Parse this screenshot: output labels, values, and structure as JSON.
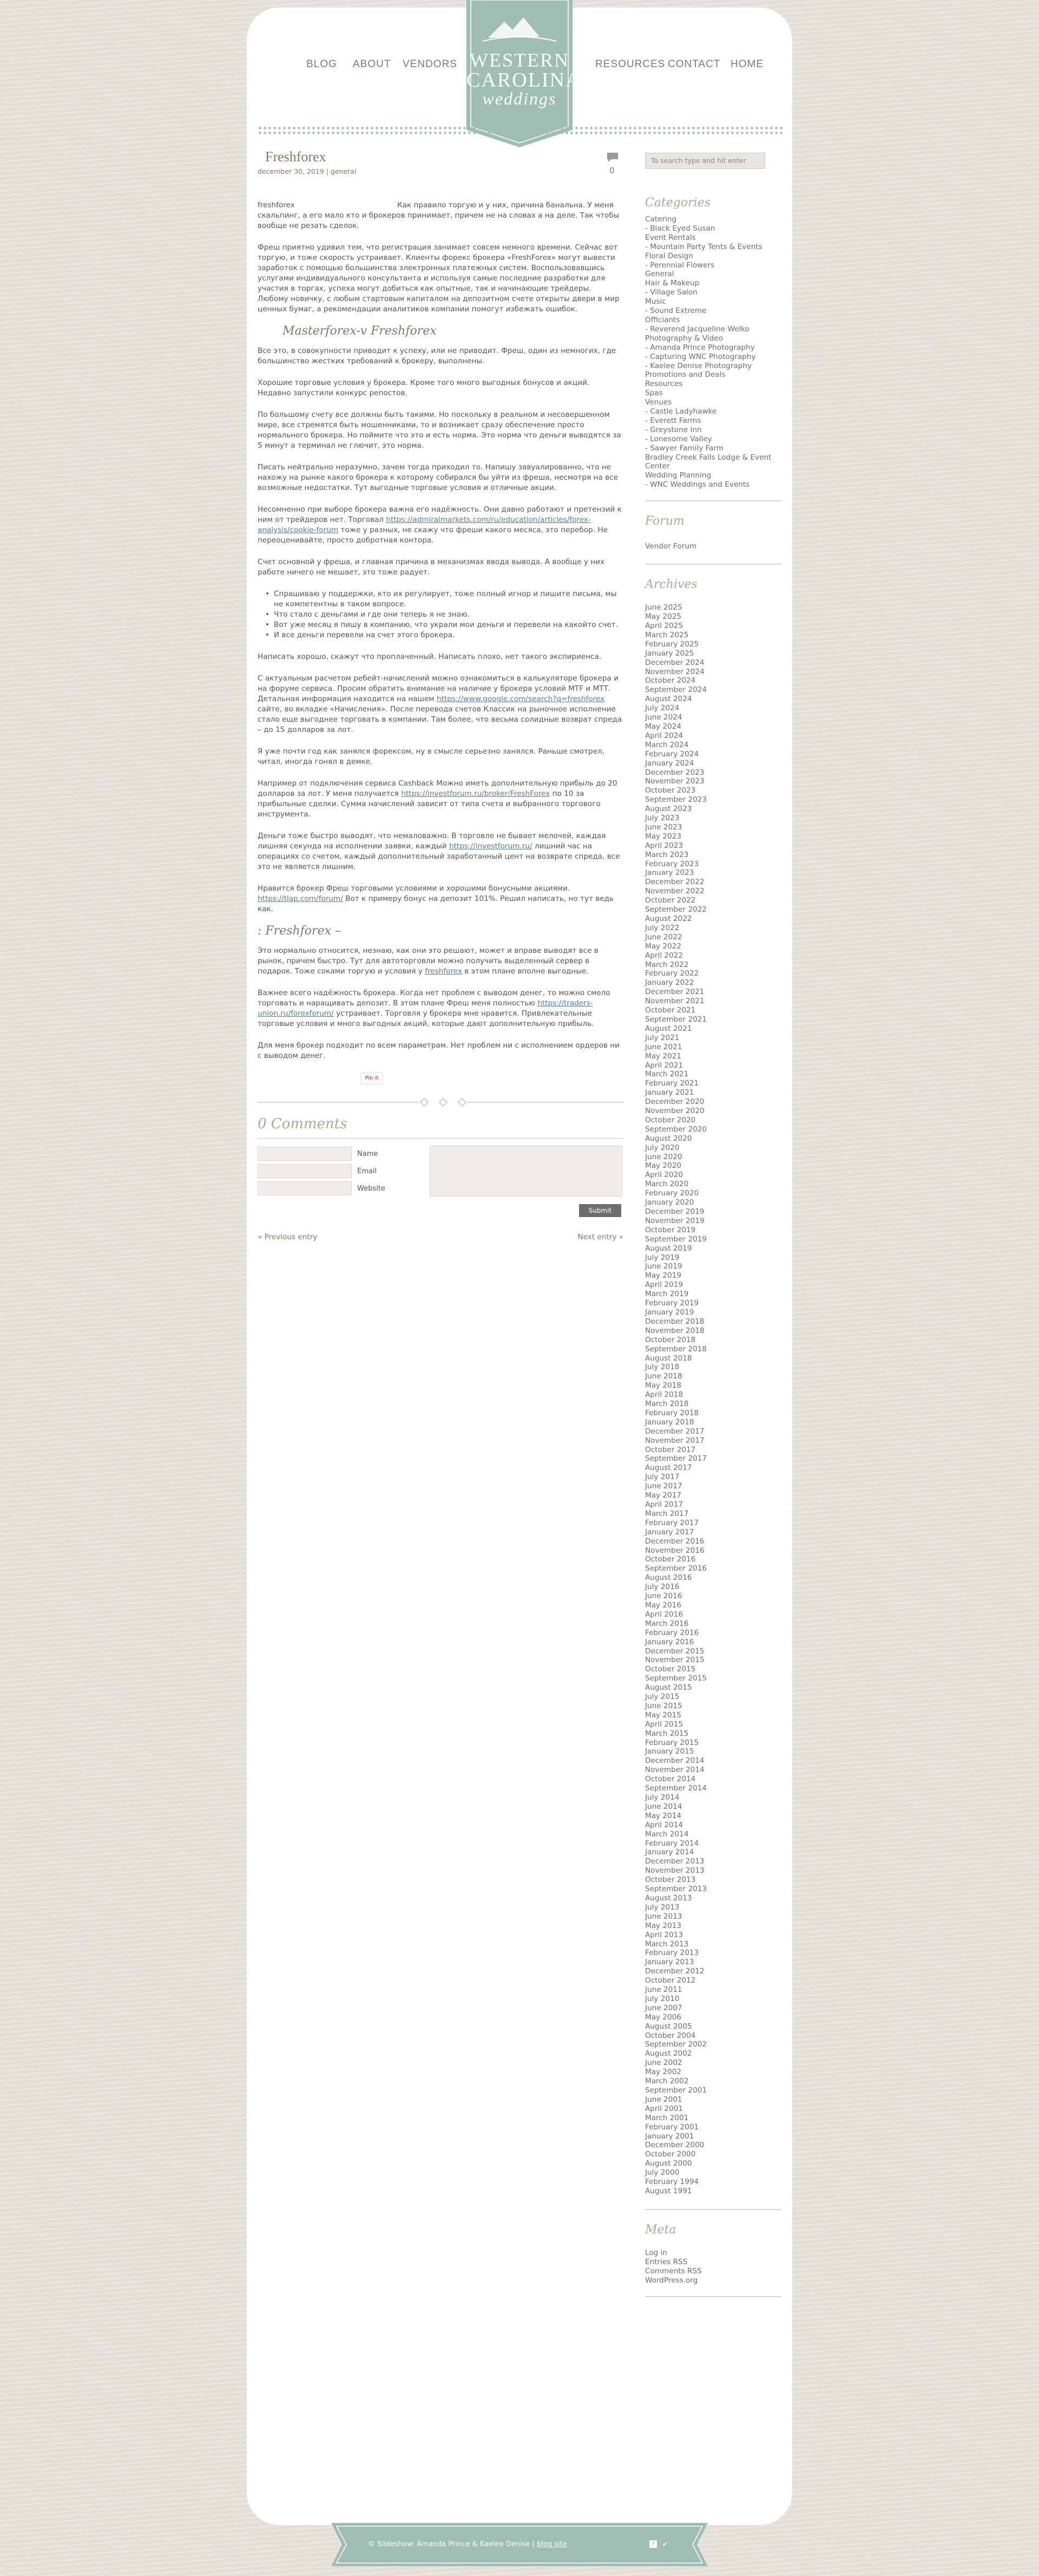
{
  "site": {
    "nav_left": [
      "BLOG",
      "ABOUT",
      "VENDORS"
    ],
    "nav_right": [
      "RESOURCES",
      "CONTACT",
      "HOME"
    ],
    "logo_line1": "WESTERN",
    "logo_line2": "CAROLINA",
    "logo_line3": "weddings",
    "brand_color": "#9fbdb4",
    "accent_color": "#8a7662"
  },
  "post": {
    "title": "Freshforex",
    "date_line": "december 30, 2019 | general",
    "comment_count": "0",
    "image_alt": "freshforex",
    "intro": "Как правило торгую и у них, причина банальна. У меня скальпинг, а его мало кто и брокеров принимает, причем не на словах а на деле. Так чтобы вообще не резать сделок.",
    "p1": "Фреш приятно удивил тем, что регистрация занимает совсем немного времени. Сейчас вот торгую, и тоже скорость устраивает. Клиенты форекс брокера «FreshForex» могут вывести заработок с помощью большинства электронных платежных систем. Воспользовавшись услугами индивидуального консультанта и используя самые последние разработки для участия в торгах, успеха могут добиться как опытные, так и начинающие трейдеры. Любому новичку, с любым стартовым капиталом на депозитном счете открыты двери в мир ценных бумаг, а рекомендации аналитиков компании помогут избежать ошибок.",
    "heading1": "Masterforex-v Freshforex",
    "p2": "Все это, в совокупности приводит к успеху, или не приводит. Фреш, один из немногих, где большинство жестких требований к брокеру, выполнены.",
    "p3": "Хорошие торговые условия у брокера. Кроме того много выгодных бонусов и акций. Недавно запустили конкурс репостов.",
    "p4": "По большому счету все должны быть такими. Но поскольку в реальном и несовершенном мире, все стремятся быть мошенниками, то и возникает сразу обеспечение просто нормального брокера. Но поймите что это и есть норма. Это норма что деньги выводятся за 5 минут а терминал не глючит, это норма.",
    "p5": "Писать нейтрально неразумно, зачем тогда приходил то. Напишу завуалированно, что не нахожу на рынке какого брокера к которому собирался бы уйти из фреша, несмотря на все возможные недостатки. Тут выгодные торговые условия и отличные акции.",
    "p6_a": "Несомненно при выборе брокера важна его надёжность. Они давно работают и претензий к ним от трейдеров нет. Торговал ",
    "p6_link": "https://admiralmarkets.com/ru/education/articles/forex-analysis/cookie-forum",
    "p6_b": " тоже у разных, не скажу что фреши какого месяса, это перебор. Не переоценивайте, просто добротная контора.",
    "p7": "Счет основной у фреша, и главная причина в механизмах ввода вывода. А вообще у них работе ничего не мешает, это тоже радует.",
    "list": [
      "Спрашиваю у поддержки, кто их регулирует, тоже полный игнор и пишите письма, мы не компетентны в таком вопросе.",
      "Что стало с деньгами и где они теперь я не знаю.",
      "Вот уже месяц я пишу в компанию, что украли мои деньги и перевели на какойто счет.",
      "И все деньги перевели на счет этого брокера."
    ],
    "p8": "Написать хорошо, скажут что проплаченный. Написать плохо, нет такого экспириенса.",
    "p9_a": "С актуальным расчетом ребейт-начислений можно ознакомиться в калькуляторе брокера и на форуме сервиса. Просим обратить внимание на наличие у брокера условий МТF и МТТ. Детальная информация находится на нашем ",
    "p9_link": "https://www.google.com/search?q=freshforex",
    "p9_b": " сайте, во вкладке «Начисления». После перевода счетов Классик на рыночное исполнение стало еще выгоднее торговать в компании. Там более, что весьма солидные возврат спреда – до 15 долларов за лот.",
    "p10": "Я уже почти год как занялся форексом, ну в смысле серьезно занялся. Раньше смотрел, читал, иногда гонял в демке.",
    "p11_a": "Например от подключения сервиса Cashback Можно иметь дополнительную прибыль до 20 долларов за лот. У меня получается ",
    "p11_link": "https://investforum.ru/broker/FreshForex",
    "p11_b": " по 10 за прибыльные сделки. Сумма начислений зависит от типа счета и выбранного торгового инструмента.",
    "p12_a": "Деньги тоже быстро выводят, что немаловажно. В торговле не бывает мелочей, каждая лишняя секунда на исполнении заявки, каждый ",
    "p12_link": "https://investforum.ru/",
    "p12_b": " лишний час на операциях со счетом, каждый дополнительный заработанный цент на возврате спреда, все это не является лишним.",
    "p13_a": "Нравится брокер Фреш торговыми условиями и хорошими бонусными акциями. ",
    "p13_link": "https://tlap.com/forum/",
    "p13_b": " Вот к примеру бонус на депозит 101%. Решил написать, но тут ведь как.",
    "heading2": ": Freshforex –",
    "p14_a": "Это нормально относится, незнаю, как они это решают, может и вправе выводят все в рынок, причем быстро. Тут для автоторговли можно получить выделенный сервер в подарок. Тоже соками торгую и условия у ",
    "p14_link": "freshforex",
    "p14_b": " в этом плане вполне выгодные.",
    "p15_a": "Важнее всего надёжность брокера. Когда нет проблем с выводом денег, то можно смело торговать и наращивать депозит. В этом плане Фреш меня полностью ",
    "p15_link": "https://traders-union.ru/forexforum/",
    "p15_b": " устраивает. Торговля у брокера мне нравится. Привлекательные торговые условия и много выгодных акций, которые дают дополнительную прибыль.",
    "p16": "Для меня брокер подходит по всем параметрам. Нет проблем ни с исполнением ордеров ни с выводом денег.",
    "pin_label": "Pin it"
  },
  "comments": {
    "heading": "0 Comments",
    "name_label": "Name",
    "email_label": "Email",
    "website_label": "Website",
    "submit_label": "Submit",
    "prev": "« Previous entry",
    "next": "Next entry »"
  },
  "sidebar": {
    "search_placeholder": "To search type and hit enter",
    "categories_heading": "Categories",
    "categories": [
      "Catering",
      "- Black Eyed Susan",
      "Event Rentals",
      "- Mountain Party Tents & Events",
      "Floral Design",
      "- Perennial Flowers",
      "General",
      "Hair & Makeup",
      "- Village Salon",
      "Music",
      "- Sound Extreme",
      "Officiants",
      "- Reverend Jacqueline Welko",
      "Photography & Video",
      "- Amanda Prince Photography",
      "- Capturing WNC Photography",
      "- Kaelee Denise Photography",
      "Promotions and Deals",
      "Resources",
      "Spas",
      "Venues",
      "- Castle Ladyhawke",
      "- Everett Farms",
      "- Greystone Inn",
      "- Lonesome Valley",
      "- Sawyer Family Farm",
      "Bradley Creek Falls Lodge & Event",
      "Center",
      "Wedding Planning",
      "- WNC Weddings and Events"
    ],
    "forum_heading": "Forum",
    "forum_link": "Vendor Forum",
    "archives_heading": "Archives",
    "archives": [
      "June 2025",
      "May 2025",
      "April 2025",
      "March 2025",
      "February 2025",
      "January 2025",
      "December 2024",
      "November 2024",
      "October 2024",
      "September 2024",
      "August 2024",
      "July 2024",
      "June 2024",
      "May 2024",
      "April 2024",
      "March 2024",
      "February 2024",
      "January 2024",
      "December 2023",
      "November 2023",
      "October 2023",
      "September 2023",
      "August 2023",
      "July 2023",
      "June 2023",
      "May 2023",
      "April 2023",
      "March 2023",
      "February 2023",
      "January 2023",
      "December 2022",
      "November 2022",
      "October 2022",
      "September 2022",
      "August 2022",
      "July 2022",
      "June 2022",
      "May 2022",
      "April 2022",
      "March 2022",
      "February 2022",
      "January 2022",
      "December 2021",
      "November 2021",
      "October 2021",
      "September 2021",
      "August 2021",
      "July 2021",
      "June 2021",
      "May 2021",
      "April 2021",
      "March 2021",
      "February 2021",
      "January 2021",
      "December 2020",
      "November 2020",
      "October 2020",
      "September 2020",
      "August 2020",
      "July 2020",
      "June 2020",
      "May 2020",
      "April 2020",
      "March 2020",
      "February 2020",
      "January 2020",
      "December 2019",
      "November 2019",
      "October 2019",
      "September 2019",
      "August 2019",
      "July 2019",
      "June 2019",
      "May 2019",
      "April 2019",
      "March 2019",
      "February 2019",
      "January 2019",
      "December 2018",
      "November 2018",
      "October 2018",
      "September 2018",
      "August 2018",
      "July 2018",
      "June 2018",
      "May 2018",
      "April 2018",
      "March 2018",
      "February 2018",
      "January 2018",
      "December 2017",
      "November 2017",
      "October 2017",
      "September 2017",
      "August 2017",
      "July 2017",
      "June 2017",
      "May 2017",
      "April 2017",
      "March 2017",
      "February 2017",
      "January 2017",
      "December 2016",
      "November 2016",
      "October 2016",
      "September 2016",
      "August 2016",
      "July 2016",
      "June 2016",
      "May 2016",
      "April 2016",
      "March 2016",
      "February 2016",
      "January 2016",
      "December 2015",
      "November 2015",
      "October 2015",
      "September 2015",
      "August 2015",
      "July 2015",
      "June 2015",
      "May 2015",
      "April 2015",
      "March 2015",
      "February 2015",
      "January 2015",
      "December 2014",
      "November 2014",
      "October 2014",
      "September 2014",
      "July 2014",
      "June 2014",
      "May 2014",
      "April 2014",
      "March 2014",
      "February 2014",
      "January 2014",
      "December 2013",
      "November 2013",
      "October 2013",
      "September 2013",
      "August 2013",
      "July 2013",
      "June 2013",
      "May 2013",
      "April 2013",
      "March 2013",
      "February 2013",
      "January 2013",
      "December 2012",
      "October 2012",
      "June 2011",
      "July 2010",
      "June 2007",
      "May 2006",
      "August 2005",
      "October 2004",
      "September 2002",
      "August 2002",
      "June 2002",
      "May 2002",
      "March 2002",
      "September 2001",
      "June 2001",
      "April 2001",
      "March 2001",
      "February 2001",
      "January 2001",
      "December 2000",
      "October 2000",
      "August 2000",
      "July 2000",
      "February 1994",
      "August 1991"
    ],
    "meta_heading": "Meta",
    "meta": [
      "Log in",
      "Entries RSS",
      "Comments RSS",
      "WordPress.org"
    ]
  },
  "footer": {
    "text": "© Slideshow: Amanda Prince & Kaelee Denise",
    "blog_link": "blog site",
    "icons": [
      "facebook-icon",
      "twitter-icon"
    ]
  }
}
